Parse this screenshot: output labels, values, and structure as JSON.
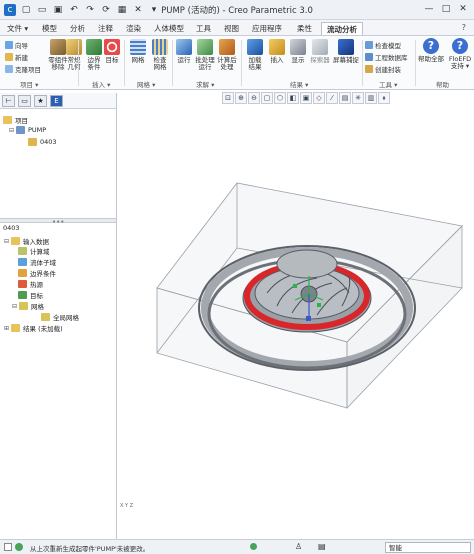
{
  "window": {
    "title": "PUMP (活动的) - Creo Parametric 3.0"
  },
  "tabs": [
    "文件 ▾",
    "模型",
    "分析",
    "注释",
    "渲染",
    "人体模型",
    "工具",
    "视图",
    "应用程序",
    "柔性",
    "流动分析"
  ],
  "active_tab": "流动分析",
  "ribbon": {
    "small_buttons": [
      "向导",
      "新建",
      "克隆项目"
    ],
    "buttons": [
      {
        "label": "零组件\n移除"
      },
      {
        "label": "常规\n几何"
      },
      {
        "label": "边界\n条件"
      },
      {
        "label": "目标"
      },
      {
        "label": "网格"
      },
      {
        "label": "检查\n网格"
      },
      {
        "label": "运行"
      },
      {
        "label": "批处理\n运行"
      },
      {
        "label": "计算后\n处理"
      },
      {
        "label": "加载\n结果"
      },
      {
        "label": "插入"
      },
      {
        "label": "显示"
      },
      {
        "label": "探索器"
      },
      {
        "label": "屏幕捕捉"
      }
    ],
    "tools_small": [
      "检查模型",
      "工程数据库",
      "创建封装"
    ],
    "help_buttons": [
      "帮助全部",
      "FloEFD\n支持 ▾"
    ],
    "groups": [
      "项目 ▾",
      "插入 ▾",
      "网格 ▾",
      "求解 ▾",
      "结果 ▾",
      "工具 ▾",
      "帮助"
    ]
  },
  "model_tree": {
    "root": "项目",
    "items": [
      {
        "label": "PUMP",
        "depth": 1
      },
      {
        "label": "0403",
        "depth": 2
      }
    ]
  },
  "flow_tree": {
    "header": "0403",
    "items": [
      {
        "label": "输入数据",
        "depth": 1
      },
      {
        "label": "计算域",
        "depth": 2
      },
      {
        "label": "流体子域",
        "depth": 2
      },
      {
        "label": "边界条件",
        "depth": 2
      },
      {
        "label": "热源",
        "depth": 2
      },
      {
        "label": "目标",
        "depth": 2
      },
      {
        "label": "网格",
        "depth": 2
      },
      {
        "label": "全局网格",
        "depth": 3
      },
      {
        "label": "结果 (未加载)",
        "depth": 1
      }
    ]
  },
  "viewport": {
    "coord_label": "X  Y  Z",
    "colors": {
      "ring": "#d8262a",
      "rotor_blue": "#3a58c8",
      "axis_green": "#2ab34a"
    }
  },
  "statusbar": {
    "message": "从上次重新生成起零件'PUMP'未被更改。",
    "filter": "智能"
  },
  "colors": {
    "accent": "#2a6bc4",
    "help": "#3a6fd0"
  }
}
